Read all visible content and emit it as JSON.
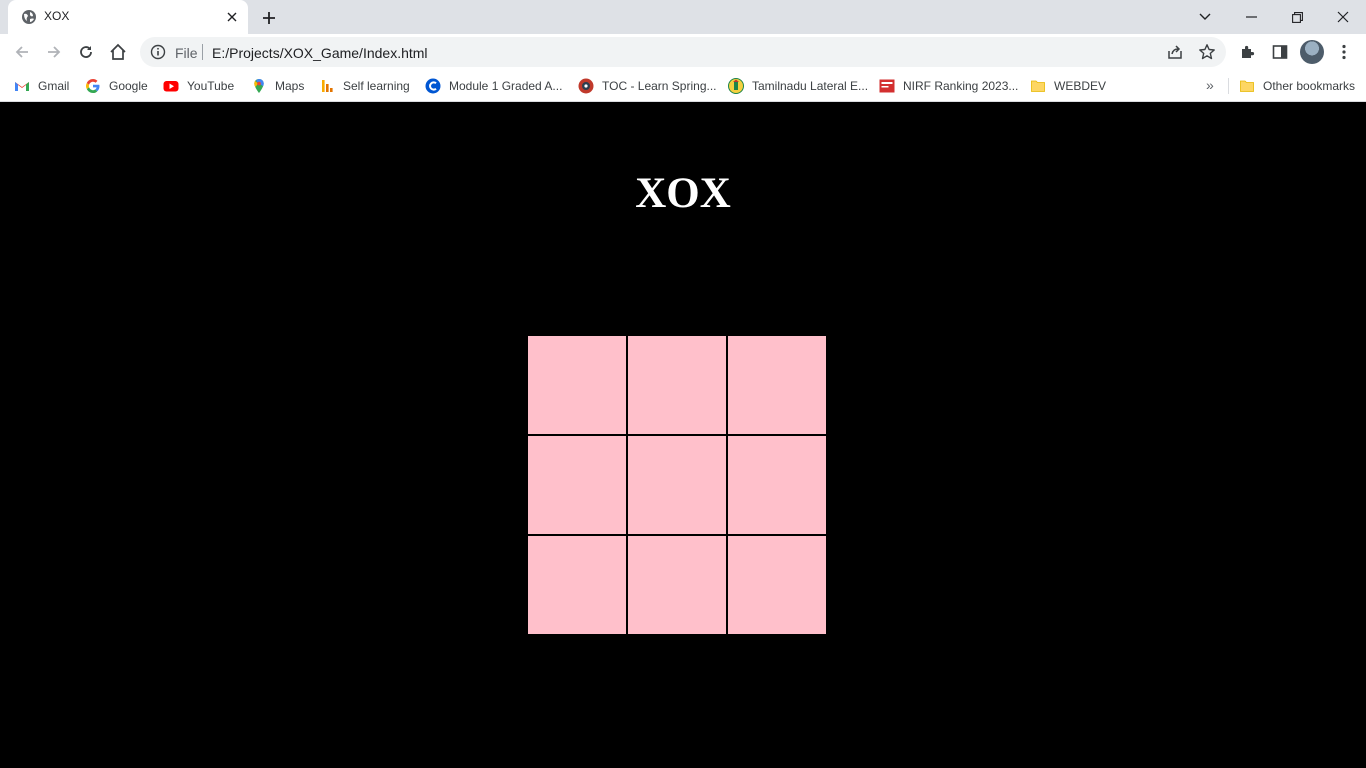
{
  "browser": {
    "tab": {
      "title": "XOX"
    },
    "omnibox": {
      "scheme_label": "File",
      "url": "E:/Projects/XOX_Game/Index.html"
    },
    "bookmarks": [
      {
        "label": "Gmail",
        "icon": "gmail-icon"
      },
      {
        "label": "Google",
        "icon": "google-icon"
      },
      {
        "label": "YouTube",
        "icon": "youtube-icon"
      },
      {
        "label": "Maps",
        "icon": "maps-icon"
      },
      {
        "label": "Self learning",
        "icon": "analytics-icon"
      },
      {
        "label": "Module 1 Graded A...",
        "icon": "coursera-icon"
      },
      {
        "label": "TOC - Learn Spring...",
        "icon": "spring-icon"
      },
      {
        "label": "Tamilnadu Lateral E...",
        "icon": "emblem-icon"
      },
      {
        "label": "NIRF Ranking 2023...",
        "icon": "nirf-icon"
      },
      {
        "label": "WEBDEV",
        "icon": "folder-icon"
      }
    ],
    "overflow": "»",
    "other_bookmarks": {
      "label": "Other bookmarks",
      "icon": "folder-icon"
    }
  },
  "game": {
    "title": "XOX",
    "cells": [
      "",
      "",
      "",
      "",
      "",
      "",
      "",
      "",
      ""
    ],
    "colors": {
      "background": "#000000",
      "cell": "#ffc0cb",
      "title": "#ffffff"
    }
  }
}
